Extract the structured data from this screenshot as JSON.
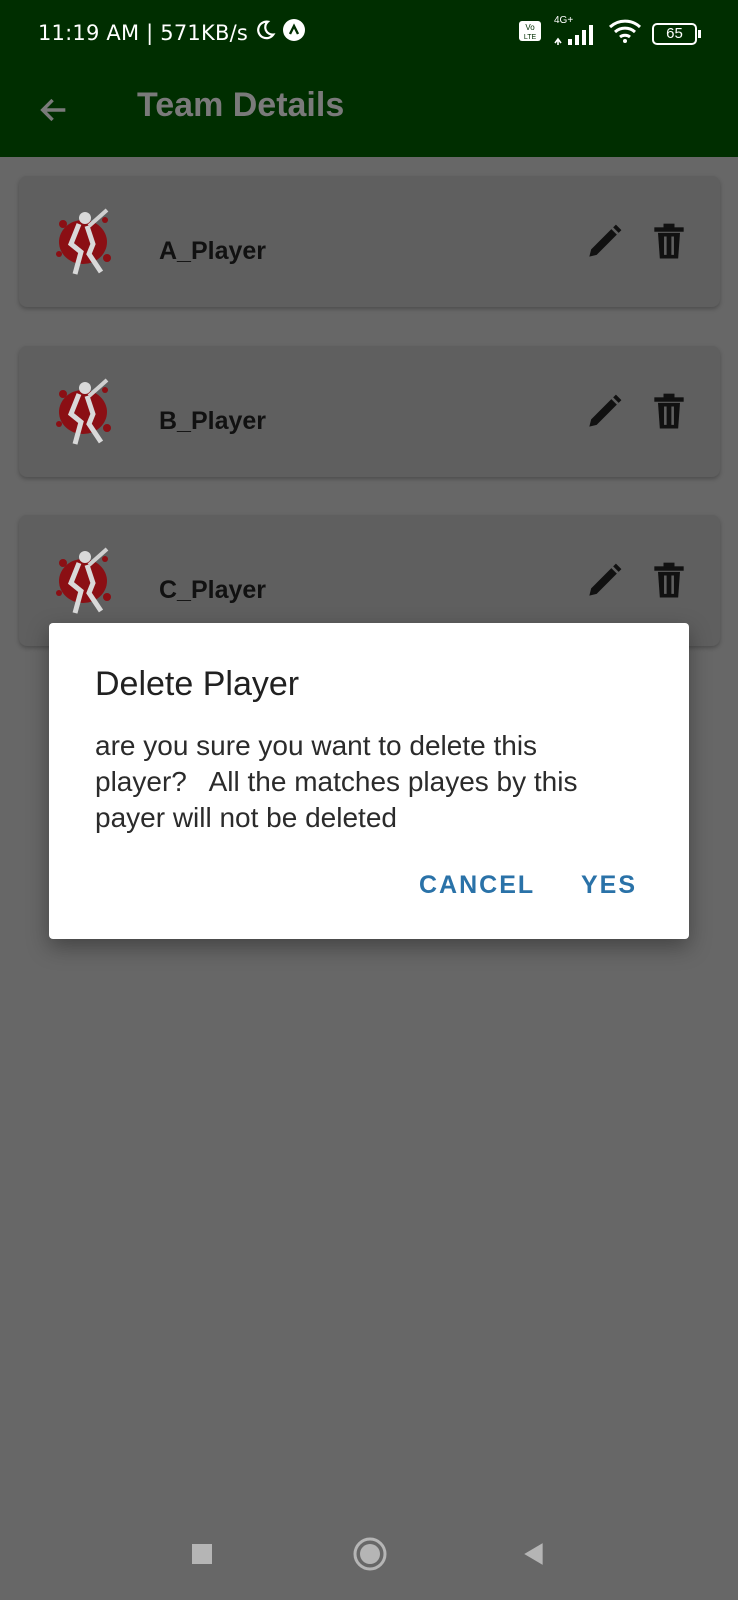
{
  "status": {
    "time_speed": "11:19 AM | 571KB/s",
    "network": "4G+",
    "battery": "65",
    "icons": [
      "moon-icon",
      "app-notification-icon",
      "volte-icon",
      "signal-icon",
      "wifi-icon",
      "battery-icon"
    ]
  },
  "appbar": {
    "title": "Team Details",
    "back_icon": "arrow-left-icon"
  },
  "players": [
    {
      "name": "A_Player"
    },
    {
      "name": "B_Player"
    },
    {
      "name": "C_Player"
    }
  ],
  "dialog": {
    "title": "Delete Player",
    "message": "are you sure you want to delete this player?   All the matches playes by this payer will not be deleted",
    "cancel_label": "CANCEL",
    "yes_label": "YES"
  },
  "colors": {
    "appbar": "#002e00",
    "accent_button": "#2a72a8",
    "avatar_red": "#8b0f14"
  }
}
